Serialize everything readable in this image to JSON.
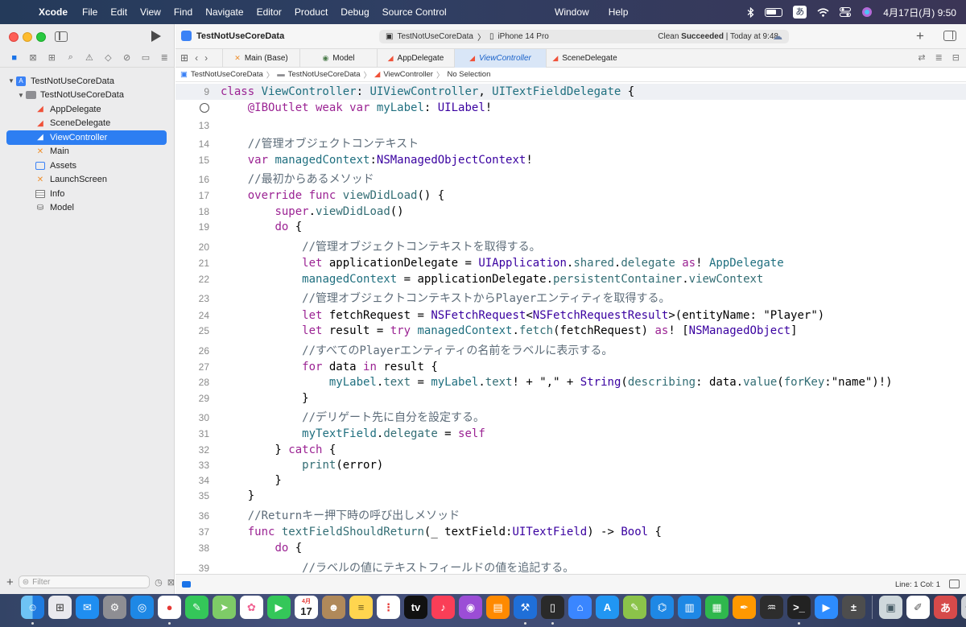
{
  "menubar": {
    "apple": "",
    "app": "Xcode",
    "items": [
      "File",
      "Edit",
      "View",
      "Find",
      "Navigate",
      "Editor",
      "Product",
      "Debug",
      "Source Control"
    ],
    "center_items": [
      "Window",
      "Help"
    ],
    "ime": "あ",
    "datetime": "4月17日(月) 9:50"
  },
  "sidebar": {
    "filter_placeholder": "Filter",
    "tree": [
      {
        "label": "TestNotUseCoreData",
        "kind": "project",
        "depth": 0,
        "disclosure": "v"
      },
      {
        "label": "TestNotUseCoreData",
        "kind": "folder",
        "depth": 1,
        "disclosure": "v"
      },
      {
        "label": "AppDelegate",
        "kind": "swift",
        "depth": 2
      },
      {
        "label": "SceneDelegate",
        "kind": "swift",
        "depth": 2
      },
      {
        "label": "ViewController",
        "kind": "swift",
        "depth": 2,
        "selected": true
      },
      {
        "label": "Main",
        "kind": "xib",
        "depth": 2
      },
      {
        "label": "Assets",
        "kind": "assets",
        "depth": 2
      },
      {
        "label": "LaunchScreen",
        "kind": "xib",
        "depth": 2
      },
      {
        "label": "Info",
        "kind": "plist",
        "depth": 2
      },
      {
        "label": "Model",
        "kind": "model",
        "depth": 2
      }
    ]
  },
  "toolbar": {
    "project_title": "TestNotUseCoreData",
    "scheme": "TestNotUseCoreData",
    "device": "iPhone 14 Pro",
    "status_prefix": "Clean ",
    "status_bold": "Succeeded",
    "status_suffix": " | Today at 9:48"
  },
  "tabs": [
    {
      "label": "Main (Base)",
      "icon": "✕"
    },
    {
      "label": "Model",
      "icon": "◉"
    },
    {
      "label": "AppDelegate",
      "icon": "◢"
    },
    {
      "label": "ViewController",
      "icon": "◢",
      "active": true
    },
    {
      "label": "SceneDelegate",
      "icon": "◢"
    }
  ],
  "jumpbar": [
    "TestNotUseCoreData",
    "TestNotUseCoreData",
    "ViewController",
    "No Selection"
  ],
  "code": {
    "line_9_number": "9",
    "lines": [
      {
        "n": "9",
        "first": true,
        "tokens": [
          [
            "kw",
            "class "
          ],
          [
            "cls",
            "ViewController"
          ],
          [
            "",
            ": "
          ],
          [
            "cls",
            "UIViewController"
          ],
          [
            "",
            ", "
          ],
          [
            "cls",
            "UITextFieldDelegate"
          ],
          [
            "",
            " {"
          ]
        ]
      },
      {
        "n": "",
        "breakpoint": true,
        "tokens": [
          [
            "",
            "    "
          ],
          [
            "kw",
            "@IBOutlet weak var "
          ],
          [
            "cls",
            "myLabel"
          ],
          [
            "",
            ": "
          ],
          [
            "ty2",
            "UILabel"
          ],
          [
            "",
            "!"
          ]
        ]
      },
      {
        "n": "13",
        "tokens": []
      },
      {
        "n": "14",
        "tokens": [
          [
            "cm",
            "    //管理オブジェクトコンテキスト"
          ]
        ]
      },
      {
        "n": "15",
        "tokens": [
          [
            "",
            "    "
          ],
          [
            "kw",
            "var "
          ],
          [
            "cls",
            "managedContext"
          ],
          [
            "",
            ":"
          ],
          [
            "ty2",
            "NSManagedObjectContext"
          ],
          [
            "",
            "!"
          ]
        ]
      },
      {
        "n": "16",
        "tokens": [
          [
            "cm",
            "    //最初からあるメソッド"
          ]
        ]
      },
      {
        "n": "17",
        "tokens": [
          [
            "",
            "    "
          ],
          [
            "kw",
            "override func "
          ],
          [
            "fn",
            "viewDidLoad"
          ],
          [
            "",
            "() {"
          ]
        ]
      },
      {
        "n": "18",
        "tokens": [
          [
            "",
            "        "
          ],
          [
            "kw",
            "super"
          ],
          [
            "",
            "."
          ],
          [
            "prop",
            "viewDidLoad"
          ],
          [
            "",
            "()"
          ]
        ]
      },
      {
        "n": "19",
        "tokens": [
          [
            "",
            "        "
          ],
          [
            "kw",
            "do"
          ],
          [
            "",
            " {"
          ]
        ]
      },
      {
        "n": "20",
        "tokens": [
          [
            "cm",
            "            //管理オブジェクトコンテキストを取得する。"
          ]
        ]
      },
      {
        "n": "21",
        "tokens": [
          [
            "",
            "            "
          ],
          [
            "kw",
            "let "
          ],
          [
            "",
            "applicationDelegate = "
          ],
          [
            "ty2",
            "UIApplication"
          ],
          [
            "",
            "."
          ],
          [
            "prop",
            "shared"
          ],
          [
            "",
            "."
          ],
          [
            "prop",
            "delegate"
          ],
          [
            "",
            " "
          ],
          [
            "kw",
            "as"
          ],
          [
            "",
            "! "
          ],
          [
            "cls",
            "AppDelegate"
          ]
        ]
      },
      {
        "n": "22",
        "tokens": [
          [
            "",
            "            "
          ],
          [
            "cls",
            "managedContext"
          ],
          [
            "",
            " = applicationDelegate."
          ],
          [
            "prop",
            "persistentContainer"
          ],
          [
            "",
            "."
          ],
          [
            "prop",
            "viewContext"
          ]
        ]
      },
      {
        "n": "23",
        "tokens": [
          [
            "cm",
            "            //管理オブジェクトコンテキストからPlayerエンティティを取得する。"
          ]
        ]
      },
      {
        "n": "24",
        "tokens": [
          [
            "",
            "            "
          ],
          [
            "kw",
            "let "
          ],
          [
            "",
            "fetchRequest = "
          ],
          [
            "ty2",
            "NSFetchRequest"
          ],
          [
            "",
            "<"
          ],
          [
            "ty2",
            "NSFetchRequestResult"
          ],
          [
            "",
            ">(entityName: \"Player\")"
          ]
        ]
      },
      {
        "n": "25",
        "tokens": [
          [
            "",
            "            "
          ],
          [
            "kw",
            "let "
          ],
          [
            "",
            "result = "
          ],
          [
            "kw",
            "try "
          ],
          [
            "cls",
            "managedContext"
          ],
          [
            "",
            "."
          ],
          [
            "prop",
            "fetch"
          ],
          [
            "",
            "(fetchRequest) "
          ],
          [
            "kw",
            "as"
          ],
          [
            "",
            "! ["
          ],
          [
            "ty2",
            "NSManagedObject"
          ],
          [
            "",
            "]"
          ]
        ]
      },
      {
        "n": "26",
        "tokens": [
          [
            "cm",
            "            //すべてのPlayerエンティティの名前をラベルに表示する。"
          ]
        ]
      },
      {
        "n": "27",
        "tokens": [
          [
            "",
            "            "
          ],
          [
            "kw",
            "for "
          ],
          [
            "",
            "data "
          ],
          [
            "kw",
            "in "
          ],
          [
            "",
            "result {"
          ]
        ]
      },
      {
        "n": "28",
        "tokens": [
          [
            "",
            "                "
          ],
          [
            "cls",
            "myLabel"
          ],
          [
            "",
            "."
          ],
          [
            "prop",
            "text"
          ],
          [
            "",
            " = "
          ],
          [
            "cls",
            "myLabel"
          ],
          [
            "",
            "."
          ],
          [
            "prop",
            "text"
          ],
          [
            "",
            "! + \",\" + "
          ],
          [
            "ty2",
            "String"
          ],
          [
            "",
            "("
          ],
          [
            "prop",
            "describing"
          ],
          [
            "",
            ": data."
          ],
          [
            "prop",
            "value"
          ],
          [
            "",
            "("
          ],
          [
            "prop",
            "forKey"
          ],
          [
            "",
            ":\"name\")!)"
          ]
        ]
      },
      {
        "n": "29",
        "tokens": [
          [
            "",
            "            }"
          ]
        ]
      },
      {
        "n": "30",
        "tokens": [
          [
            "cm",
            "            //デリゲート先に自分を設定する。"
          ]
        ]
      },
      {
        "n": "31",
        "tokens": [
          [
            "",
            "            "
          ],
          [
            "cls",
            "myTextField"
          ],
          [
            "",
            "."
          ],
          [
            "prop",
            "delegate"
          ],
          [
            "",
            " = "
          ],
          [
            "kw",
            "self"
          ]
        ]
      },
      {
        "n": "32",
        "tokens": [
          [
            "",
            "        } "
          ],
          [
            "kw",
            "catch"
          ],
          [
            "",
            " {"
          ]
        ]
      },
      {
        "n": "33",
        "tokens": [
          [
            "",
            "            "
          ],
          [
            "prop",
            "print"
          ],
          [
            "",
            "(error)"
          ]
        ]
      },
      {
        "n": "34",
        "tokens": [
          [
            "",
            "        }"
          ]
        ]
      },
      {
        "n": "35",
        "tokens": [
          [
            "",
            "    }"
          ]
        ]
      },
      {
        "n": "36",
        "tokens": [
          [
            "cm",
            "    //Returnキー押下時の呼び出しメソッド"
          ]
        ]
      },
      {
        "n": "37",
        "tokens": [
          [
            "",
            "    "
          ],
          [
            "kw",
            "func "
          ],
          [
            "fn",
            "textFieldShouldReturn"
          ],
          [
            "",
            "(_ textField:"
          ],
          [
            "ty2",
            "UITextField"
          ],
          [
            "",
            ") -> "
          ],
          [
            "ty2",
            "Bool"
          ],
          [
            "",
            " {"
          ]
        ]
      },
      {
        "n": "38",
        "tokens": [
          [
            "",
            "        "
          ],
          [
            "kw",
            "do"
          ],
          [
            "",
            " {"
          ]
        ]
      },
      {
        "n": "39",
        "tokens": [
          [
            "cm",
            "            //ラベルの値にテキストフィールドの値を追記する。"
          ]
        ]
      }
    ]
  },
  "statusbar": {
    "position": "Line: 1  Col: 1"
  },
  "dock": {
    "apps": [
      "finder",
      "launchpad",
      "mail",
      "system-settings",
      "safari",
      "chrome",
      "messages",
      "maps",
      "photos",
      "facetime",
      "calendar",
      "contacts",
      "notes",
      "reminders",
      "apple-tv",
      "music",
      "podcasts",
      "books",
      "xcode",
      "simulator",
      "appstore-connect",
      "app-store",
      "script-editor",
      "vscode",
      "keynote",
      "numbers",
      "pages",
      "activity",
      "terminal",
      "zoom",
      "calculator",
      "preview",
      "textedit",
      "kotoeri",
      "trash"
    ],
    "calendar_month": "4月",
    "calendar_day": "17",
    "apple_tv_label": "tv",
    "ime_label": "あ"
  },
  "colors": {
    "keyword": "#9b2393",
    "type": "#3900a0",
    "project_symbol": "#1f6f7f",
    "comment": "#5d6c79",
    "selection": "#2d7ef2"
  }
}
